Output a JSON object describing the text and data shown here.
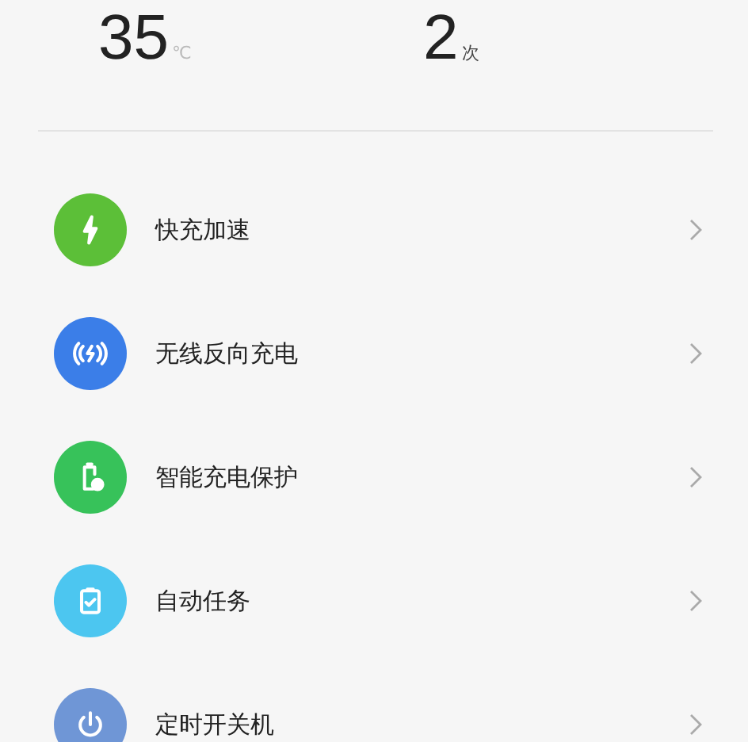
{
  "stats": [
    {
      "value": "35",
      "unit": "℃"
    },
    {
      "value": "2",
      "unit": "次"
    }
  ],
  "items": [
    {
      "label": "快充加速",
      "kind": "bolt",
      "color": "#5cbf38"
    },
    {
      "label": "无线反向充电",
      "kind": "wireless",
      "color": "#3b7ee8"
    },
    {
      "label": "智能充电保护",
      "kind": "battery",
      "color": "#37c25a"
    },
    {
      "label": "自动任务",
      "kind": "task",
      "color": "#4cc6f0"
    },
    {
      "label": "定时开关机",
      "kind": "power",
      "color": "#6f96d6"
    }
  ]
}
